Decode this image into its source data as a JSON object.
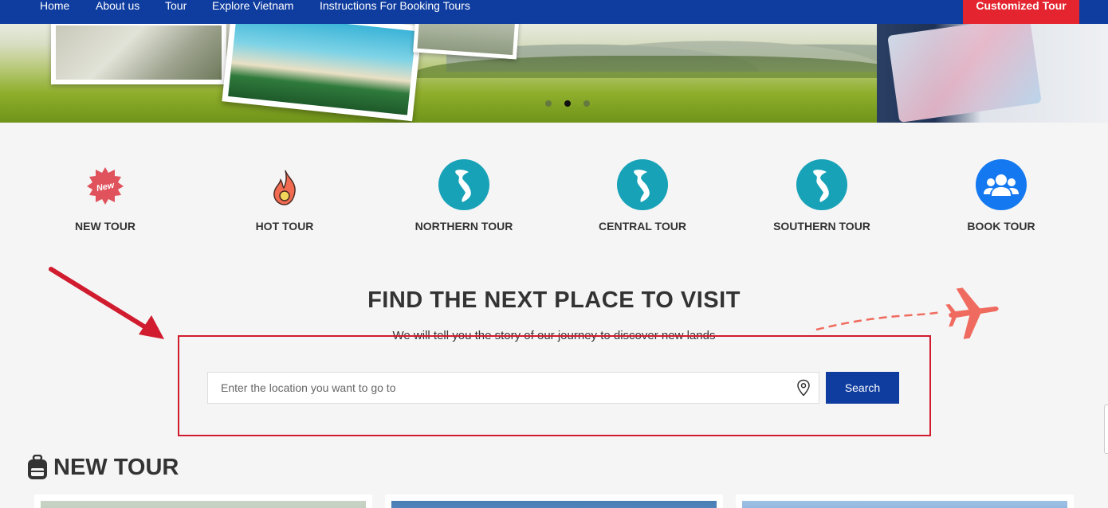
{
  "nav": {
    "items": [
      {
        "label": "Home"
      },
      {
        "label": "About us"
      },
      {
        "label": "Tour"
      },
      {
        "label": "Explore Vietnam"
      },
      {
        "label": "Instructions For Booking Tours"
      }
    ],
    "cta_label": "Customized Tour"
  },
  "hero": {
    "slides": 3,
    "active_slide": 2,
    "new_badge": "New"
  },
  "categories": [
    {
      "label": "NEW TOUR",
      "icon": "new-badge-icon"
    },
    {
      "label": "HOT TOUR",
      "icon": "fire-icon"
    },
    {
      "label": "NORTHERN TOUR",
      "icon": "vietnam-map-icon"
    },
    {
      "label": "CENTRAL TOUR",
      "icon": "vietnam-map-icon"
    },
    {
      "label": "SOUTHERN TOUR",
      "icon": "vietnam-map-icon"
    },
    {
      "label": "BOOK TOUR",
      "icon": "users-icon"
    }
  ],
  "search": {
    "title": "FIND THE NEXT PLACE TO VISIT",
    "subtitle": "We will tell you the story of our journey to discover new lands",
    "placeholder": "Enter the location you want to go to",
    "button_label": "Search"
  },
  "new_tour": {
    "title": "NEW TOUR"
  },
  "colors": {
    "nav_bg": "#0e3c9f",
    "cta_bg": "#e4252f",
    "teal": "#17a2b8",
    "blue": "#1479f0",
    "highlight": "#d01c2e"
  }
}
